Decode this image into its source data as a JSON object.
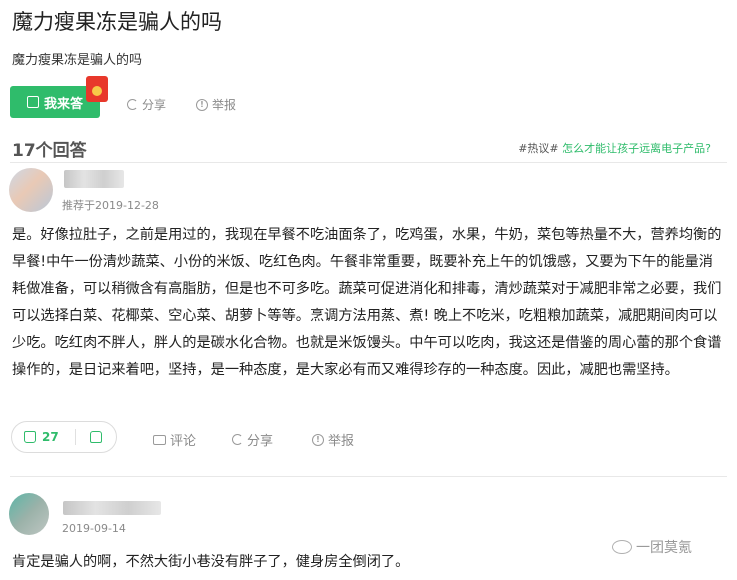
{
  "question": {
    "title": "魔力瘦果冻是骗人的吗",
    "subtitle": "魔力瘦果冻是骗人的吗"
  },
  "question_actions": {
    "answer_label": "我来答",
    "share_label": "分享",
    "report_label": "举报"
  },
  "answers_header": {
    "count_label": "17个回答",
    "hot_tag": "#热议#",
    "hot_question": "怎么才能让孩子远离电子产品?"
  },
  "answers": [
    {
      "recommend_date": "推荐于2019-12-28",
      "content": "是。好像拉肚子，之前是用过的，我现在早餐不吃油面条了，吃鸡蛋，水果，牛奶，菜包等热量不大，营养均衡的早餐!中午一份清炒蔬菜、小份的米饭、吃红色肉。午餐非常重要，既要补充上午的饥饿感，又要为下午的能量消耗做准备，可以稍微含有高脂肪，但是也不可多吃。蔬菜可促进消化和排毒，清炒蔬菜对于减肥非常之必要，我们可以选择白菜、花椰菜、空心菜、胡萝卜等等。烹调方法用蒸、煮! 晚上不吃米，吃粗粮加蔬菜，减肥期间肉可以少吃。吃红肉不胖人，胖人的是碳水化合物。也就是米饭馒头。中午可以吃肉，我这还是借鉴的周心蕾的那个食谱操作的，是日记来着吧，坚持，是一种态度，是大家必有而又难得珍存的一种态度。因此，减肥也需坚持。",
      "likes": "27",
      "comment_label": "评论",
      "share_label": "分享",
      "report_label": "举报"
    },
    {
      "date": "2019-09-14",
      "content": "肯定是骗人的啊，不然大街小巷没有胖子了，健身房全倒闭了。"
    }
  ],
  "watermark": "一团莫氪",
  "colors": {
    "accent": "#2fbc6b",
    "redpacket": "#e8382b"
  }
}
